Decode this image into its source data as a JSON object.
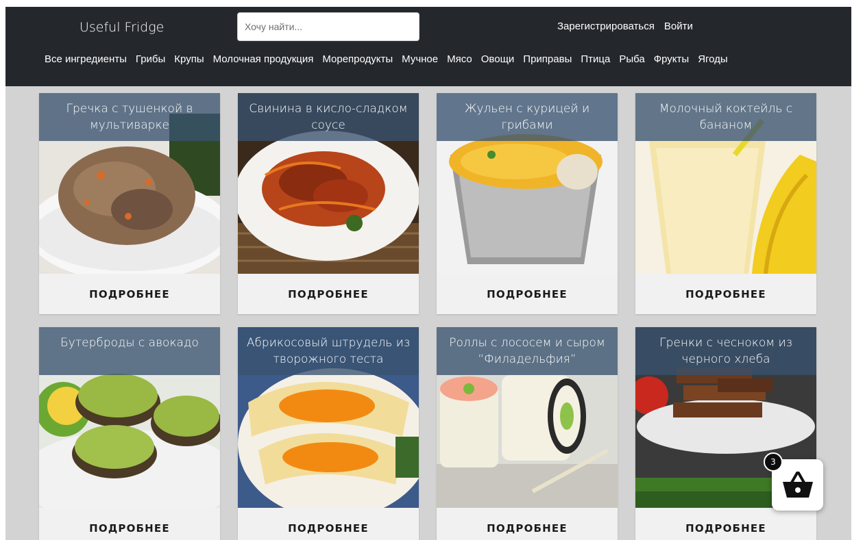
{
  "header": {
    "brand": "Useful Fridge",
    "search_placeholder": "Хочу найти...",
    "register": "Зарегистрироваться",
    "login": "Войти"
  },
  "categories": [
    "Все ингредиенты",
    "Грибы",
    "Крупы",
    "Молочная продукция",
    "Морепродукты",
    "Мучное",
    "Мясо",
    "Овощи",
    "Приправы",
    "Птица",
    "Рыба",
    "Фрукты",
    "Ягоды"
  ],
  "recipes": [
    {
      "title": "Гречка с тушенкой в мультиварке",
      "button": "ПОДРОБНЕЕ"
    },
    {
      "title": "Свинина в кисло-сладком соусе",
      "button": "ПОДРОБНЕЕ"
    },
    {
      "title": "Жульен с курицей и грибами",
      "button": "ПОДРОБНЕЕ"
    },
    {
      "title": "Молочный коктейль с бананом",
      "button": "ПОДРОБНЕЕ"
    },
    {
      "title": "Бутерброды с авокадо",
      "button": "ПОДРОБНЕЕ"
    },
    {
      "title": "Абрикосовый штрудель из творожного теста",
      "button": "ПОДРОБНЕЕ"
    },
    {
      "title": "Роллы с лососем и сыром “Филадельфия”",
      "button": "ПОДРОБНЕЕ"
    },
    {
      "title": "Гренки с чесноком из черного хлеба",
      "button": "ПОДРОБНЕЕ"
    }
  ],
  "cart": {
    "count": "3",
    "icon": "basket-icon"
  },
  "colors": {
    "navbar": "#24282d",
    "caption_overlay": "#385270",
    "page_bg": "#d3d3d3",
    "card_bg": "#efefef"
  }
}
